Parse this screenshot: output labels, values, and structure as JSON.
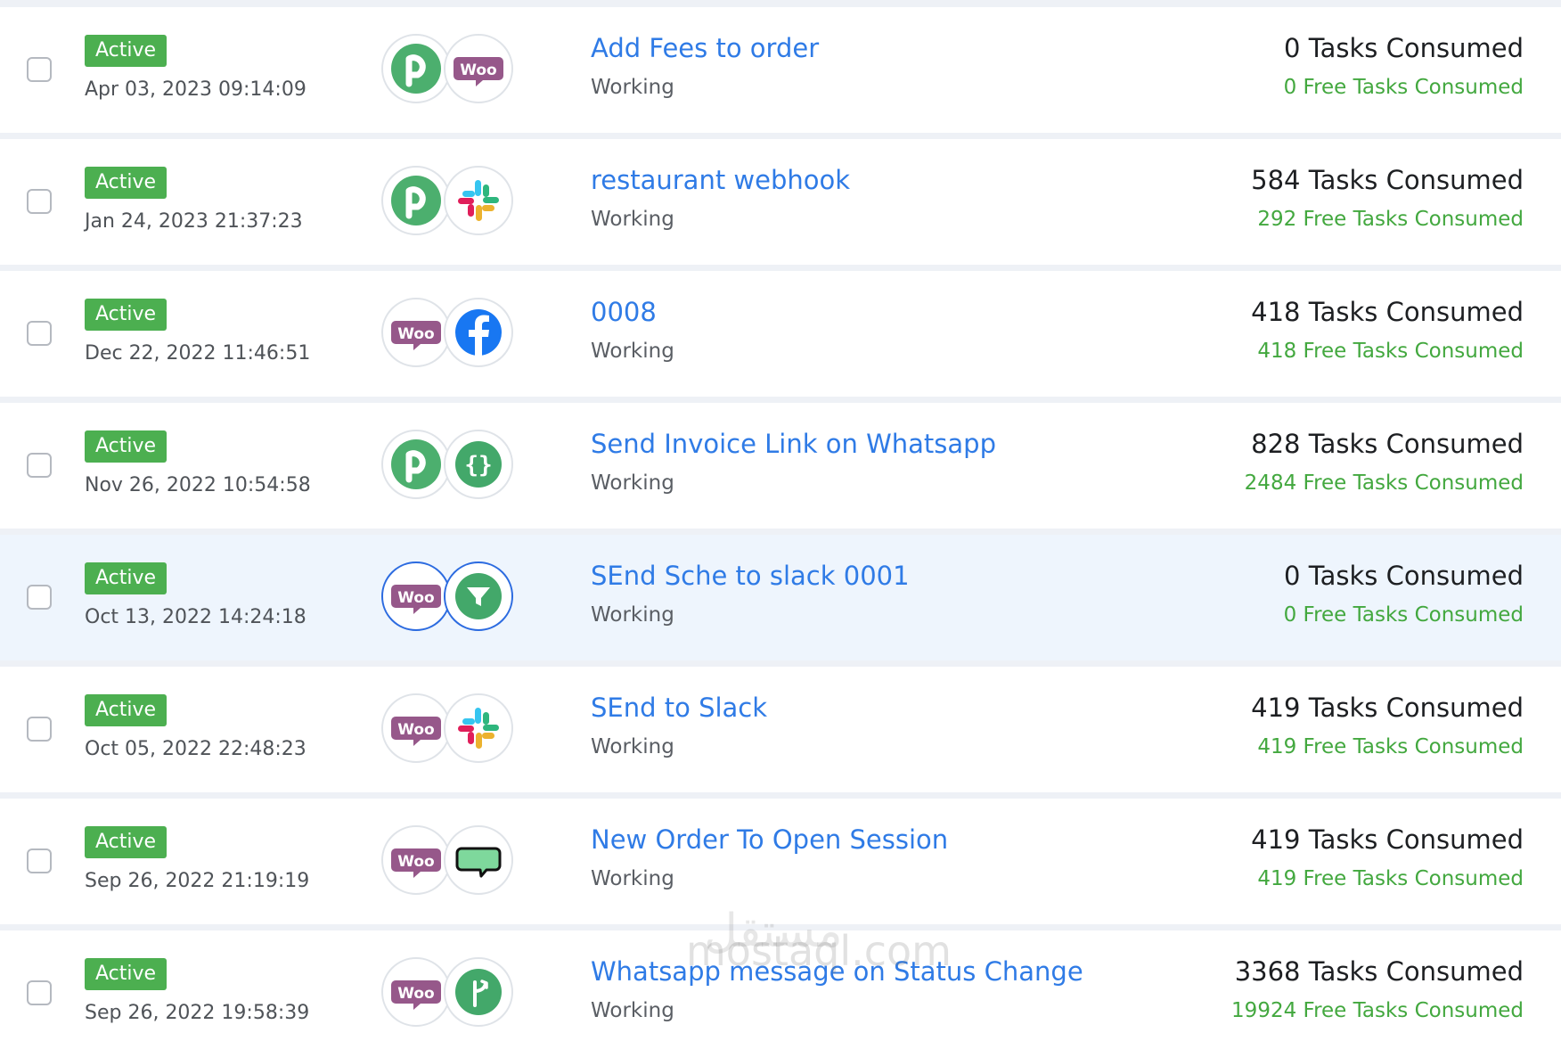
{
  "rows": [
    {
      "status_badge": "Active",
      "date": "Apr 03, 2023 09:14:09",
      "icons": [
        "pabbly-icon",
        "woocommerce-icon"
      ],
      "name": "Add Fees to order",
      "state": "Working",
      "tasks": "0 Tasks Consumed",
      "free_tasks": "0 Free Tasks Consumed",
      "highlighted": false
    },
    {
      "status_badge": "Active",
      "date": "Jan 24, 2023 21:37:23",
      "icons": [
        "pabbly-icon",
        "slack-icon"
      ],
      "name": "restaurant webhook",
      "state": "Working",
      "tasks": "584 Tasks Consumed",
      "free_tasks": "292 Free Tasks Consumed",
      "highlighted": false
    },
    {
      "status_badge": "Active",
      "date": "Dec 22, 2022 11:46:51",
      "icons": [
        "woocommerce-icon",
        "facebook-icon"
      ],
      "name": "0008",
      "state": "Working",
      "tasks": "418 Tasks Consumed",
      "free_tasks": "418 Free Tasks Consumed",
      "highlighted": false
    },
    {
      "status_badge": "Active",
      "date": "Nov 26, 2022 10:54:58",
      "icons": [
        "pabbly-icon",
        "code-braces-icon"
      ],
      "name": "Send Invoice Link on Whatsapp",
      "state": "Working",
      "tasks": "828 Tasks Consumed",
      "free_tasks": "2484 Free Tasks Consumed",
      "highlighted": false
    },
    {
      "status_badge": "Active",
      "date": "Oct 13, 2022 14:24:18",
      "icons": [
        "woocommerce-icon",
        "filter-icon"
      ],
      "name": "SEnd Sche to slack 0001",
      "state": "Working",
      "tasks": "0 Tasks Consumed",
      "free_tasks": "0 Free Tasks Consumed",
      "highlighted": true
    },
    {
      "status_badge": "Active",
      "date": "Oct 05, 2022 22:48:23",
      "icons": [
        "woocommerce-icon",
        "slack-icon"
      ],
      "name": "SEnd to Slack",
      "state": "Working",
      "tasks": "419 Tasks Consumed",
      "free_tasks": "419 Free Tasks Consumed",
      "highlighted": false
    },
    {
      "status_badge": "Active",
      "date": "Sep 26, 2022 21:19:19",
      "icons": [
        "woocommerce-icon",
        "chat-bubble-icon"
      ],
      "name": "New Order To Open Session",
      "state": "Working",
      "tasks": "419 Tasks Consumed",
      "free_tasks": "419 Free Tasks Consumed",
      "highlighted": false
    },
    {
      "status_badge": "Active",
      "date": "Sep 26, 2022 19:58:39",
      "icons": [
        "woocommerce-icon",
        "router-icon"
      ],
      "name": "Whatsapp message on Status Change",
      "state": "Working",
      "tasks": "3368 Tasks Consumed",
      "free_tasks": "19924 Free Tasks Consumed",
      "highlighted": false
    }
  ],
  "watermark": {
    "arabic": "مستقل",
    "latin": "mostaql.com"
  },
  "colors": {
    "badge": "#4caf50",
    "link": "#2f7be6",
    "free_tasks": "#43a83f",
    "highlight_row": "#eef5fd",
    "highlight_border": "#2c6be0"
  }
}
